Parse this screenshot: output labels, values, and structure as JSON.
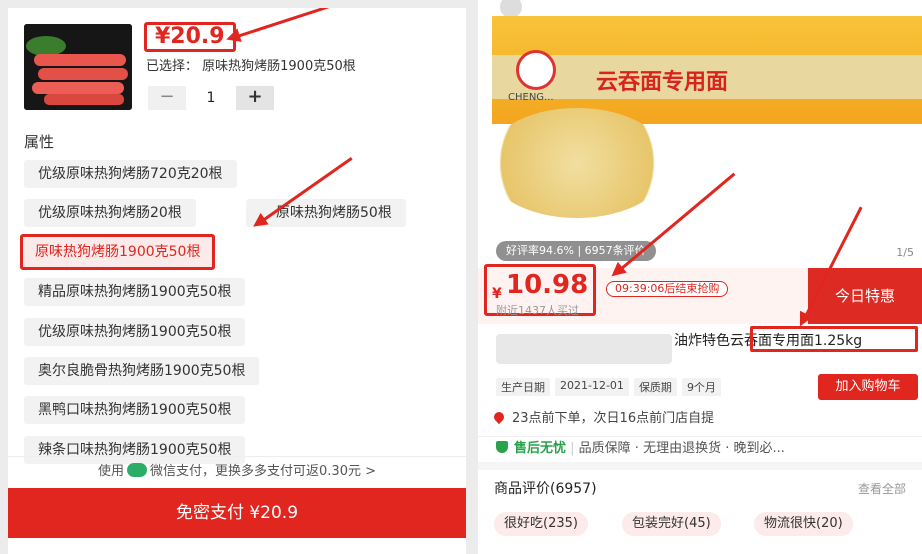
{
  "left": {
    "price": "¥20.9",
    "selected": "已选择： 原味热狗烤肠1900克50根",
    "minus": "−",
    "qty": "1",
    "plus": "+",
    "attr_title": "属性",
    "options": [
      "优级原味热狗烤肠720克20根",
      "优级原味热狗烤肠20根",
      "原味热狗烤肠50根",
      "原味热狗烤肠1900克50根",
      "精品原味热狗烤肠1900克50根",
      "优级原味热狗烤肠1900克50根",
      "奥尔良脆骨热狗烤肠1900克50根",
      "黑鸭口味热狗烤肠1900克50根",
      "辣条口味热狗烤肠1900克50根"
    ],
    "pay_info_a": "使用",
    "pay_info_b": "微信支付，更换多多支付可返0.30元 >",
    "pay_button": "免密支付 ¥20.9"
  },
  "right": {
    "box_title": "云吞面专用面",
    "box_brand": "CHENG...",
    "rating": "好评率94.6%  |  6957条评价",
    "pager": "1/5",
    "currency": "¥",
    "price": "10.98",
    "countdown": "09:39:06后结束抢购",
    "bought": "附近1437人买过",
    "promo": "今日特惠",
    "title": "油炸特色云吞面专用面1.25kg",
    "meta": [
      "生产日期",
      "2021-12-01",
      "保质期",
      "9个月"
    ],
    "cart_button": "加入购物车",
    "pickup": "23点前下单，次日16点前门店自提",
    "service_ok": "售后无忧",
    "service_rest": "品质保障 · 无理由退换货 · 晚到必...",
    "review_title": "商品评价(6957)",
    "view_all": "查看全部",
    "tags": [
      "很好吃(235)",
      "包装完好(45)",
      "物流很快(20)"
    ]
  },
  "colors": {
    "accent": "#e0261f",
    "green": "#2aae67"
  }
}
